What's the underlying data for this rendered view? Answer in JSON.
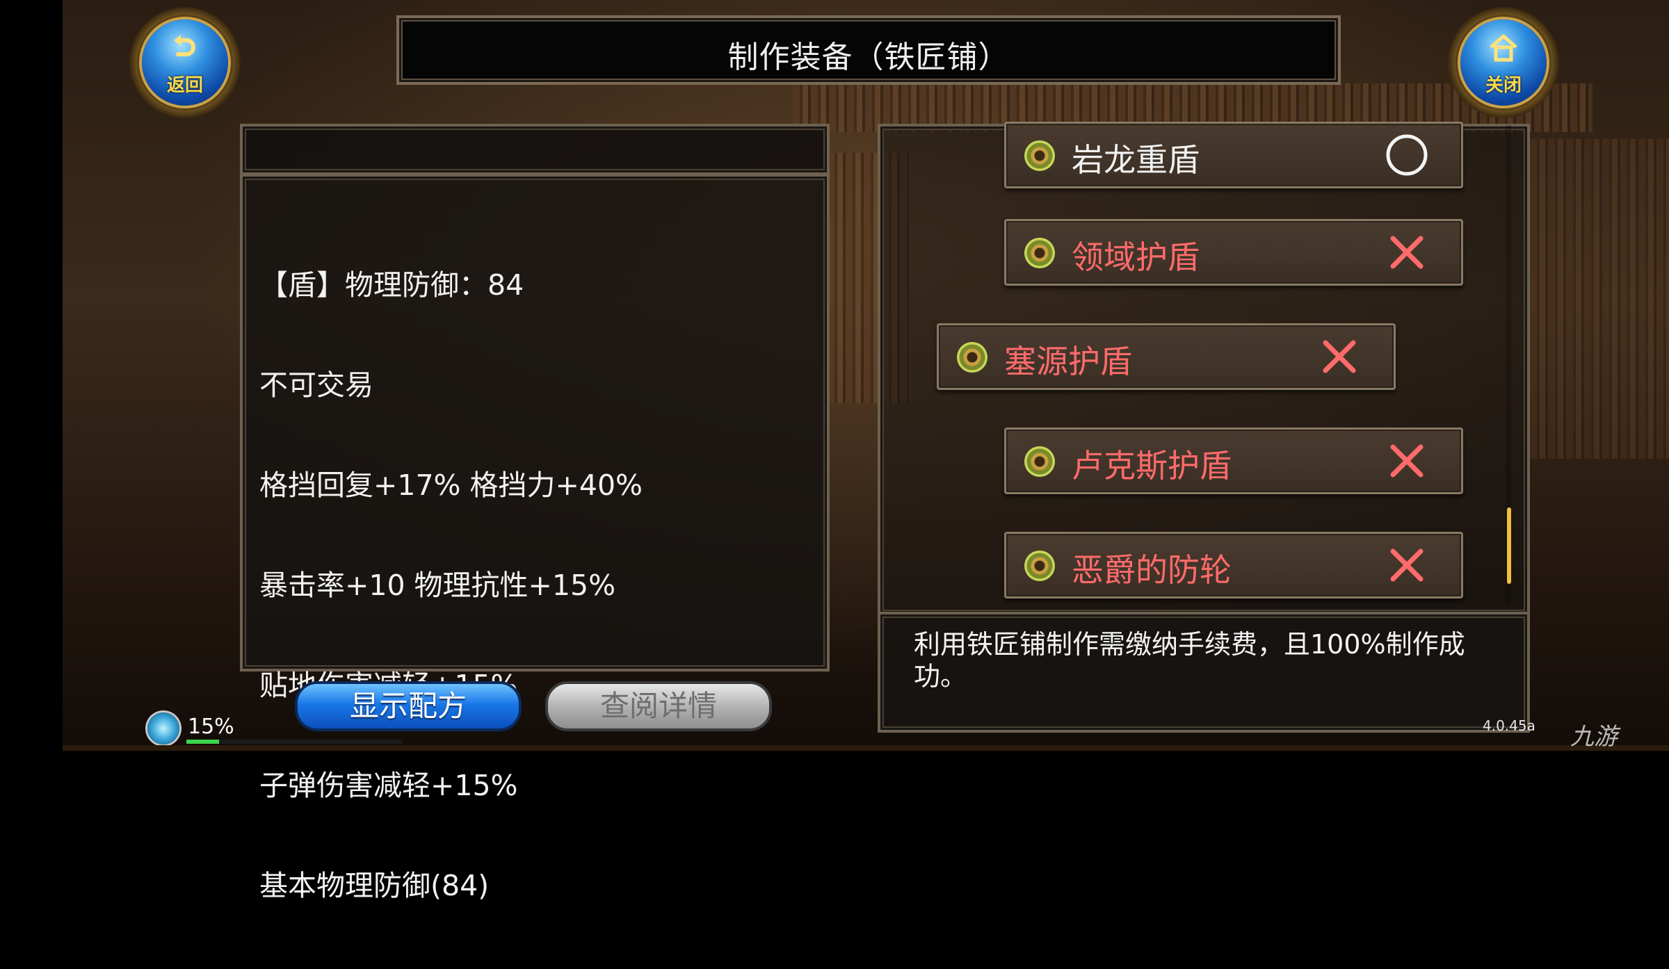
{
  "header": {
    "title": "制作装备（铁匠铺）",
    "back_label": "返回",
    "close_label": "关闭"
  },
  "item_detail": {
    "lines": [
      "【盾】物理防御：84",
      "不可交易",
      "格挡回复+17% 格挡力+40%",
      "暴击率+10 物理抗性+15%",
      "贴地伤害减轻+15%",
      "子弹伤害减轻+15%",
      "基本物理防御(84)"
    ]
  },
  "recipe_list": {
    "items": [
      {
        "name": "岩龙重盾",
        "status": "circle-icon",
        "color": "#f2f2f2"
      },
      {
        "name": "领域护盾",
        "status": "cross-icon",
        "color": "#ff6b6b"
      },
      {
        "name": "塞源护盾",
        "status": "cross-icon",
        "color": "#ff6b6b"
      },
      {
        "name": "卢克斯护盾",
        "status": "cross-icon",
        "color": "#ff6b6b"
      },
      {
        "name": "恶爵的防轮",
        "status": "cross-icon",
        "color": "#ff6b6b"
      }
    ]
  },
  "description": "利用铁匠铺制作需缴纳手续费，且100%制作成功。",
  "buttons": {
    "show_recipe": "显示配方",
    "view_details": "查阅详情"
  },
  "status": {
    "exp_percent": "15%",
    "exp_fraction": 0.15,
    "version": "4.0.45a",
    "watermark": "九游"
  },
  "colors": {
    "accent_gold": "#ffd84a",
    "cross_red": "#ff6b6b",
    "exp_green": "#3bd34a"
  }
}
